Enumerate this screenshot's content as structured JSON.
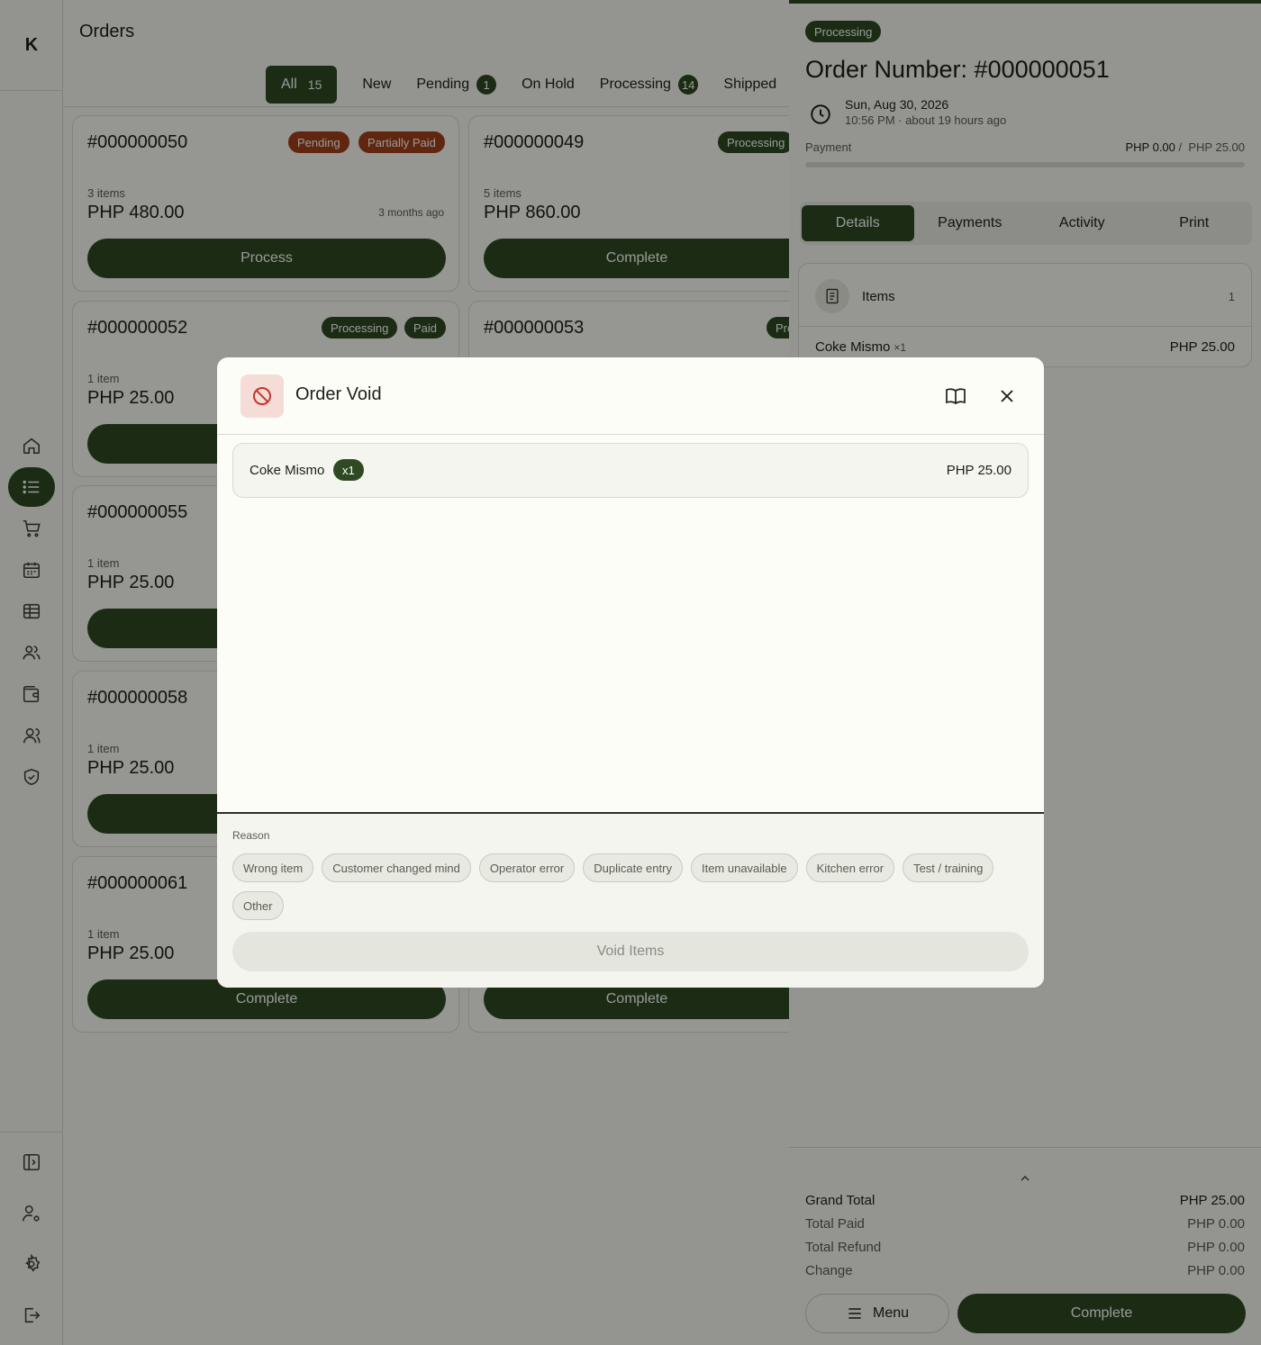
{
  "sidebar": {
    "logo": "K"
  },
  "header": {
    "title": "Orders"
  },
  "tabs": [
    {
      "label": "All",
      "count": "15"
    },
    {
      "label": "New"
    },
    {
      "label": "Pending",
      "count": "1"
    },
    {
      "label": "On Hold"
    },
    {
      "label": "Processing",
      "count": "14"
    },
    {
      "label": "Shipped"
    }
  ],
  "cards": [
    {
      "number": "#000000050",
      "badges": [
        "Pending",
        "Partially Paid"
      ],
      "items": "3 items",
      "amount": "PHP 480.00",
      "ago": "3 months ago",
      "action": "Process"
    },
    {
      "number": "#000000049",
      "badges": [
        "Processing"
      ],
      "items": "5 items",
      "amount": "PHP 860.00",
      "action": "Complete"
    },
    {
      "number": "#000000052",
      "badges": [
        "Processing",
        "Paid"
      ],
      "items": "1 item",
      "amount": "PHP 25.00"
    },
    {
      "number": "#000000053",
      "badges": [
        "Processing"
      ]
    },
    {
      "number": "#000000055",
      "items": "1 item",
      "amount": "PHP 25.00"
    },
    {
      "number": "#000000058",
      "items": "1 item",
      "amount": "PHP 25.00"
    },
    {
      "number": "#000000061",
      "items": "1 item",
      "amount": "PHP 25.00",
      "action": "Complete"
    },
    {
      "action": "Complete"
    }
  ],
  "order": {
    "status": "Processing",
    "title": "Order Number: #000000051",
    "date": "Sun, Aug 30, 2026",
    "time": "10:56 PM · about 19 hours ago",
    "payment_label": "Payment",
    "paid": "PHP 0.00",
    "total": "PHP 25.00",
    "payment_progress": 0,
    "tabs": [
      "Details",
      "Payments",
      "Activity",
      "Print"
    ],
    "items_label": "Items",
    "items_count": "1",
    "item": {
      "name": "Coke Mismo",
      "qty": "×1",
      "price": "PHP 25.00"
    },
    "totals": [
      {
        "label": "Grand Total",
        "value": "PHP 25.00"
      },
      {
        "label": "Total Paid",
        "value": "PHP 0.00"
      },
      {
        "label": "Total Refund",
        "value": "PHP 0.00"
      },
      {
        "label": "Change",
        "value": "PHP 0.00"
      }
    ],
    "menu_label": "Menu",
    "complete_label": "Complete"
  },
  "modal": {
    "title": "Order Void",
    "item": {
      "name": "Coke Mismo",
      "qty": "x1",
      "price": "PHP 25.00"
    },
    "reason_label": "Reason",
    "reasons": [
      "Wrong item",
      "Customer changed mind",
      "Operator error",
      "Duplicate entry",
      "Item unavailable",
      "Kitchen error",
      "Test / training",
      "Other"
    ],
    "void_label": "Void Items"
  },
  "colors": {
    "accent": "#2f4a22",
    "warning": "#a0401a",
    "void_icon_bg": "#f5dcd6",
    "void_icon": "#c0392b"
  }
}
